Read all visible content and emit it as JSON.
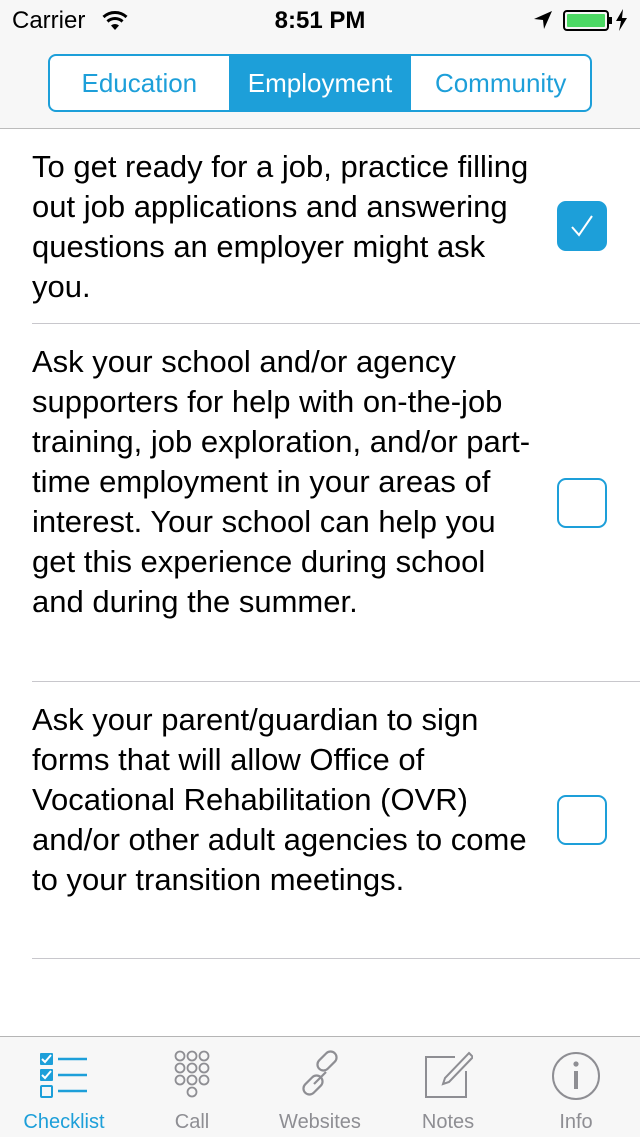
{
  "status_bar": {
    "carrier": "Carrier",
    "time": "8:51 PM",
    "icons": [
      "wifi-icon",
      "location-arrow-icon",
      "battery-charging-icon"
    ]
  },
  "segments": {
    "items": [
      {
        "label": "Education",
        "selected": false
      },
      {
        "label": "Employment",
        "selected": true
      },
      {
        "label": "Community",
        "selected": false
      }
    ]
  },
  "checklist": {
    "items": [
      {
        "text": "To get ready for a job, practice filling out job applications and answering questions an employer might ask you.",
        "checked": true
      },
      {
        "text": "Ask your school and/or agency supporters for help with on-the-job training, job exploration, and/or part-time employment in your areas of interest.  Your school can help you get this experience during school and during the summer.",
        "checked": false
      },
      {
        "text": "Ask your parent/guardian to sign forms that will allow Office of Vocational Rehabilitation (OVR) and/or other adult agencies to come to your transition meetings.",
        "checked": false
      }
    ]
  },
  "tab_bar": {
    "items": [
      {
        "label": "Checklist",
        "icon": "checklist-icon",
        "active": true
      },
      {
        "label": "Call",
        "icon": "keypad-icon",
        "active": false
      },
      {
        "label": "Websites",
        "icon": "link-icon",
        "active": false
      },
      {
        "label": "Notes",
        "icon": "notes-pencil-icon",
        "active": false
      },
      {
        "label": "Info",
        "icon": "info-icon",
        "active": false
      }
    ]
  },
  "colors": {
    "accent": "#1d9fd9",
    "inactive_tab": "#8e8e93",
    "bar_background": "#f7f7f7",
    "battery": "#4cd964"
  }
}
